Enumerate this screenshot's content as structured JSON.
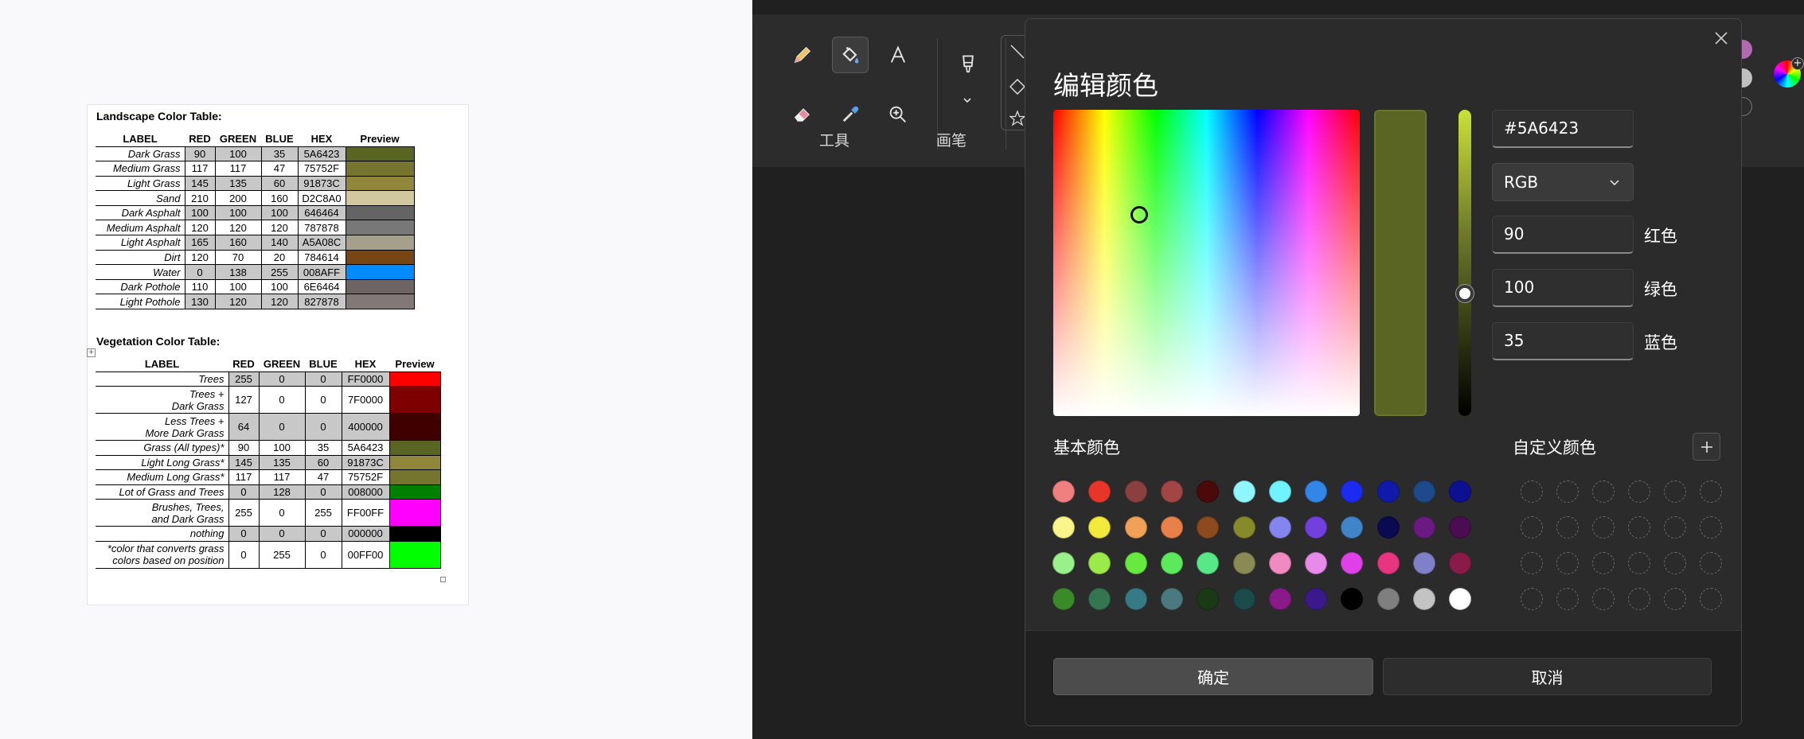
{
  "landscape_table": {
    "title": "Landscape Color Table:",
    "headers": [
      "LABEL",
      "RED",
      "GREEN",
      "BLUE",
      "HEX",
      "Preview"
    ],
    "rows": [
      {
        "label": "Dark Grass",
        "r": "90",
        "g": "100",
        "b": "35",
        "hex": "5A6423",
        "color": "#5A6423"
      },
      {
        "label": "Medium Grass",
        "r": "117",
        "g": "117",
        "b": "47",
        "hex": "75752F",
        "color": "#75752F"
      },
      {
        "label": "Light Grass",
        "r": "145",
        "g": "135",
        "b": "60",
        "hex": "91873C",
        "color": "#91873C"
      },
      {
        "label": "Sand",
        "r": "210",
        "g": "200",
        "b": "160",
        "hex": "D2C8A0",
        "color": "#D2C8A0"
      },
      {
        "label": "Dark Asphalt",
        "r": "100",
        "g": "100",
        "b": "100",
        "hex": "646464",
        "color": "#646464"
      },
      {
        "label": "Medium Asphalt",
        "r": "120",
        "g": "120",
        "b": "120",
        "hex": "787878",
        "color": "#787878"
      },
      {
        "label": "Light Asphalt",
        "r": "165",
        "g": "160",
        "b": "140",
        "hex": "A5A08C",
        "color": "#A5A08C"
      },
      {
        "label": "Dirt",
        "r": "120",
        "g": "70",
        "b": "20",
        "hex": "784614",
        "color": "#784614"
      },
      {
        "label": "Water",
        "r": "0",
        "g": "138",
        "b": "255",
        "hex": "008AFF",
        "color": "#008AFF"
      },
      {
        "label": "Dark Pothole",
        "r": "110",
        "g": "100",
        "b": "100",
        "hex": "6E6464",
        "color": "#6E6464"
      },
      {
        "label": "Light Pothole",
        "r": "130",
        "g": "120",
        "b": "120",
        "hex": "827878",
        "color": "#827878"
      }
    ]
  },
  "vegetation_table": {
    "title": "Vegetation Color Table:",
    "headers": [
      "LABEL",
      "RED",
      "GREEN",
      "BLUE",
      "HEX",
      "Preview"
    ],
    "rows": [
      {
        "label": [
          "Trees"
        ],
        "r": "255",
        "g": "0",
        "b": "0",
        "hex": "FF0000",
        "color": "#FF0000"
      },
      {
        "label": [
          "Trees +",
          "Dark Grass"
        ],
        "r": "127",
        "g": "0",
        "b": "0",
        "hex": "7F0000",
        "color": "#7F0000"
      },
      {
        "label": [
          "Less Trees +",
          "More Dark Grass"
        ],
        "r": "64",
        "g": "0",
        "b": "0",
        "hex": "400000",
        "color": "#400000"
      },
      {
        "label": [
          "Grass (All types)*"
        ],
        "r": "90",
        "g": "100",
        "b": "35",
        "hex": "5A6423",
        "color": "#5A6423"
      },
      {
        "label": [
          "Light Long Grass*"
        ],
        "r": "145",
        "g": "135",
        "b": "60",
        "hex": "91873C",
        "color": "#91873C"
      },
      {
        "label": [
          "Medium Long Grass*"
        ],
        "r": "117",
        "g": "117",
        "b": "47",
        "hex": "75752F",
        "color": "#75752F"
      },
      {
        "label": [
          "Lot of Grass and Trees"
        ],
        "r": "0",
        "g": "128",
        "b": "0",
        "hex": "008000",
        "color": "#008000"
      },
      {
        "label": [
          "Brushes, Trees,",
          "and Dark Grass"
        ],
        "r": "255",
        "g": "0",
        "b": "255",
        "hex": "FF00FF",
        "color": "#FF00FF"
      },
      {
        "label": [
          "nothing"
        ],
        "r": "0",
        "g": "0",
        "b": "0",
        "hex": "000000",
        "color": "#000000"
      },
      {
        "label": [
          "*color that converts grass",
          "colors based on position"
        ],
        "r": "0",
        "g": "255",
        "b": "0",
        "hex": "00FF00",
        "color": "#00FF00"
      }
    ]
  },
  "ribbon": {
    "tools_label": "工具",
    "brushes_label": "画笔",
    "tools": [
      {
        "name": "pencil-icon",
        "active": false
      },
      {
        "name": "fill-bucket-icon",
        "active": true
      },
      {
        "name": "text-icon",
        "active": false
      },
      {
        "name": "eraser-icon",
        "active": false
      },
      {
        "name": "color-picker-icon",
        "active": false
      },
      {
        "name": "magnifier-icon",
        "active": false
      }
    ]
  },
  "dialog": {
    "title": "编辑颜色",
    "hex_value": "#5A6423",
    "mode": "RGB",
    "red_value": "90",
    "green_value": "100",
    "blue_value": "35",
    "red_label": "红色",
    "green_label": "绿色",
    "blue_label": "蓝色",
    "current_color": "#5A6423",
    "basic_colors_label": "基本颜色",
    "custom_colors_label": "自定义颜色",
    "ok_label": "确定",
    "cancel_label": "取消",
    "basic_colors": [
      [
        "#F08080",
        "#E8352A",
        "#8B4040",
        "#A24545",
        "#4A0A0A",
        "#8FF5FF",
        "#70F2FF",
        "#3385E8",
        "#1C2BF0",
        "#0F1BA8",
        "#1E4A8C",
        "#0D1090"
      ],
      [
        "#FAF58A",
        "#F2E93A",
        "#F0A057",
        "#E8804A",
        "#8C4A1E",
        "#878A2A",
        "#8585F0",
        "#7340E0",
        "#3F85C7",
        "#0A0A50",
        "#6A1A80",
        "#4A0D52"
      ],
      [
        "#9AF08A",
        "#9AEA4A",
        "#66EA40",
        "#5CEA5C",
        "#59E887",
        "#8A8A55",
        "#F08AC0",
        "#E88AEA",
        "#E040E8",
        "#E83580",
        "#8080C8",
        "#8A1A4A"
      ],
      [
        "#3A8A2A",
        "#357550",
        "#357A85",
        "#4A7A7F",
        "#1A3A15",
        "#1A4A4A",
        "#8A1A8A",
        "#3A1A8A",
        "#000000",
        "#7F7F7F",
        "#C3C3C3",
        "#FFFFFF"
      ]
    ]
  }
}
